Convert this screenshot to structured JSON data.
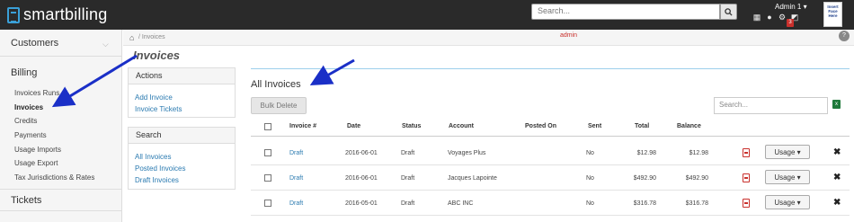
{
  "app": {
    "logo_text": "smartbilling"
  },
  "topbar": {
    "search_placeholder": "Search...",
    "admin_user": "Admin 1",
    "notification_count": "3",
    "avatar_lines": [
      "Insert",
      "Face",
      "Here"
    ],
    "icons": [
      "calendar-icon",
      "chat-icon",
      "gear-icon",
      "edit-icon"
    ]
  },
  "sidebar": {
    "sections": [
      {
        "label": "Customers"
      },
      {
        "label": "Billing"
      },
      {
        "label": "Tickets"
      }
    ],
    "billing_items": [
      {
        "label": "Invoices Runs",
        "active": false
      },
      {
        "label": "Invoices",
        "active": true
      },
      {
        "label": "Credits",
        "active": false
      },
      {
        "label": "Payments",
        "active": false
      },
      {
        "label": "Usage Imports",
        "active": false
      },
      {
        "label": "Usage Export",
        "active": false
      },
      {
        "label": "Tax Jurisdictions & Rates",
        "active": false
      }
    ]
  },
  "breadcrumb": {
    "current": "/ Invoices",
    "role_label": "admin",
    "help": "?"
  },
  "page": {
    "title": "Invoices"
  },
  "actions_panel": {
    "title": "Actions",
    "links": [
      "Add Invoice",
      "Invoice Tickets"
    ]
  },
  "search_panel": {
    "title": "Search",
    "links": [
      "All Invoices",
      "Posted Invoices",
      "Draft Invoices"
    ]
  },
  "invoices": {
    "title": "All Invoices",
    "bulk_delete_label": "Bulk Delete",
    "search_placeholder": "Search...",
    "columns": [
      "Invoice #",
      "Date",
      "Status",
      "Account",
      "Posted On",
      "Sent",
      "Total",
      "Balance"
    ],
    "rows": [
      {
        "invoice": "Draft",
        "date": "2016-06-01",
        "status": "Draft",
        "account": "Voyages Plus",
        "posted_on": "",
        "sent": "No",
        "total": "$12.98",
        "balance": "$12.98",
        "action": "Usage"
      },
      {
        "invoice": "Draft",
        "date": "2016-06-01",
        "status": "Draft",
        "account": "Jacques Lapointe",
        "posted_on": "",
        "sent": "No",
        "total": "$492.90",
        "balance": "$492.90",
        "action": "Usage"
      },
      {
        "invoice": "Draft",
        "date": "2016-05-01",
        "status": "Draft",
        "account": "ABC INC",
        "posted_on": "",
        "sent": "No",
        "total": "$316.78",
        "balance": "$316.78",
        "action": "Usage"
      }
    ]
  },
  "colors": {
    "topbar": "#2a2a2a",
    "accent": "#3aa0d8",
    "link": "#2a7ab0",
    "pdf": "#c9302c",
    "annotation_arrow": "#1a2fc7"
  }
}
